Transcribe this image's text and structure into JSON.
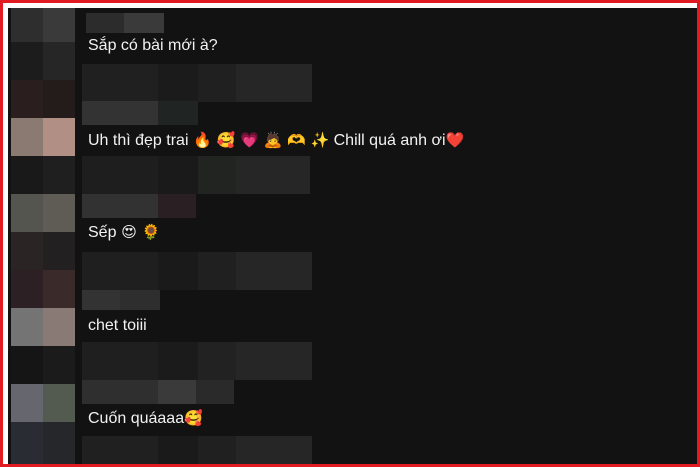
{
  "comments": [
    {
      "text": "Sắp có bài mới à?"
    },
    {
      "text": "Uh thì đẹp trai",
      "emoji_suffix": " 🔥 🥰 💗  🙇 🫶 ✨",
      "tail": " Chill quá anh ơi",
      "heart": "❤️"
    },
    {
      "text": "Sếp",
      "emoji_suffix": " 😍 🌻"
    },
    {
      "text": "chet toiii"
    },
    {
      "text": "Cuốn quáaaa",
      "emoji_suffix": "🥰"
    }
  ],
  "colors": {
    "frame_border": "#e21b23",
    "background": "#121212",
    "text": "#f2f2f2"
  }
}
